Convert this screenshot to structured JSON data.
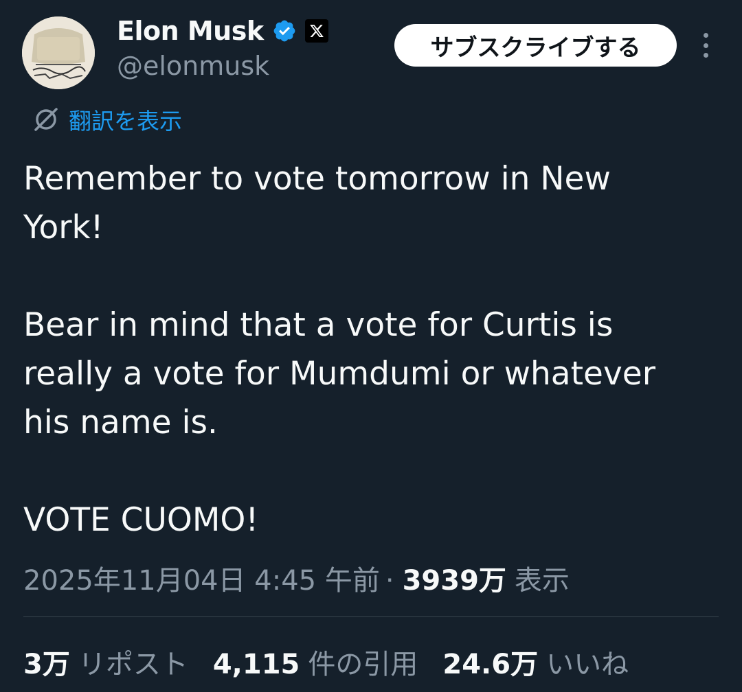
{
  "author": {
    "name": "Elon Musk",
    "handle": "@elonmusk"
  },
  "header": {
    "subscribe_label": "サブスクライブする"
  },
  "translate": {
    "label": "翻訳を表示"
  },
  "post": {
    "text": "Remember to vote tomorrow in New\nYork!\n\nBear in mind that a vote for Curtis is\nreally a vote for Mumdumi or whatever\nhis name is.\n\nVOTE CUOMO!"
  },
  "meta": {
    "timestamp": "2025年11月04日 4:45 午前",
    "separator": "·",
    "views": "3939万",
    "views_label": "表示"
  },
  "stats": {
    "reposts": "3万",
    "reposts_label": "リポスト",
    "quotes": "4,115",
    "quotes_label": "件の引用",
    "likes": "24.6万",
    "likes_label": "いいね"
  },
  "colors": {
    "background": "#15202b",
    "accent": "#1d9bf0",
    "secondary_text": "#8b98a5",
    "verified": "#1d9bf0"
  },
  "icons": [
    "verified-badge-icon",
    "x-logo-icon",
    "more-options-icon",
    "translate-icon"
  ]
}
